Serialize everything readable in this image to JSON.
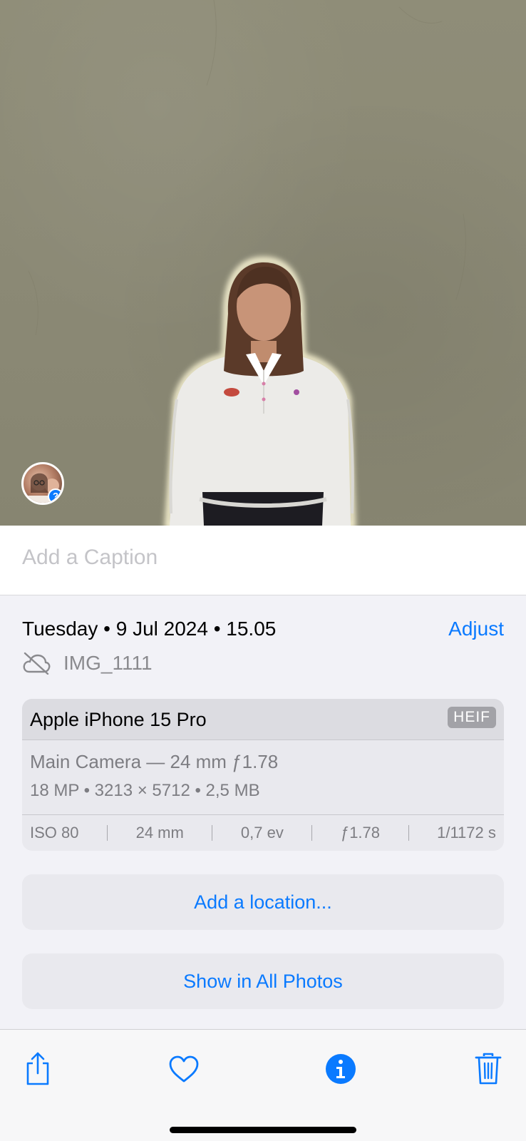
{
  "photo": {
    "alt_subject": "person",
    "face_badge_icon": "unknown-person-question-icon"
  },
  "caption": {
    "placeholder": "Add a Caption"
  },
  "info": {
    "date_time": "Tuesday • 9 Jul 2024 • 15.05",
    "adjust_label": "Adjust",
    "cloud_icon": "cloud-off-icon",
    "filename": "IMG_1111"
  },
  "camera": {
    "model": "Apple iPhone 15 Pro",
    "format": "HEIF",
    "lens": "Main Camera — 24 mm ƒ1.78",
    "specs": "18 MP  •  3213 × 5712  •  2,5 MB",
    "exif": {
      "iso": "ISO 80",
      "focal": "24 mm",
      "ev": "0,7 ev",
      "aperture": "ƒ1.78",
      "shutter": "1/1172 s"
    }
  },
  "actions": {
    "add_location": "Add a location...",
    "show_all_photos": "Show in All Photos"
  },
  "toolbar": {
    "share_icon": "share-icon",
    "favorite_icon": "heart-icon",
    "info_icon": "info-icon",
    "delete_icon": "trash-icon"
  },
  "colors": {
    "accent": "#0a7aff",
    "background": "#f2f2f7",
    "card": "#e9e9ee"
  }
}
